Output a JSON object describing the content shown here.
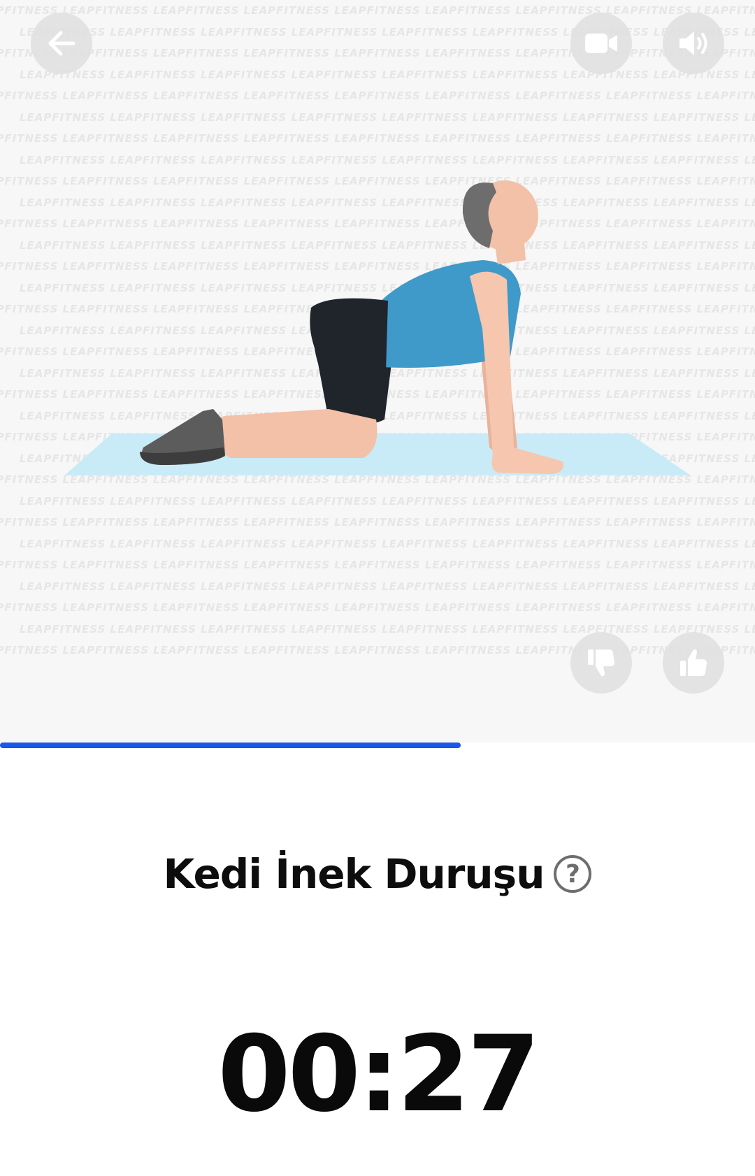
{
  "watermark_text": "LEAPFITNESS",
  "exercise": {
    "name": "Kedi İnek Duruşu",
    "help_symbol": "?"
  },
  "timer": {
    "display": "00:27"
  },
  "progress": {
    "fraction": 0.61,
    "color": "#1a56e8"
  },
  "icons": {
    "back": "arrow-left-icon",
    "video": "video-camera-icon",
    "sound": "speaker-icon",
    "dislike": "thumbs-down-icon",
    "like": "thumbs-up-icon",
    "help": "question-circle-icon"
  }
}
